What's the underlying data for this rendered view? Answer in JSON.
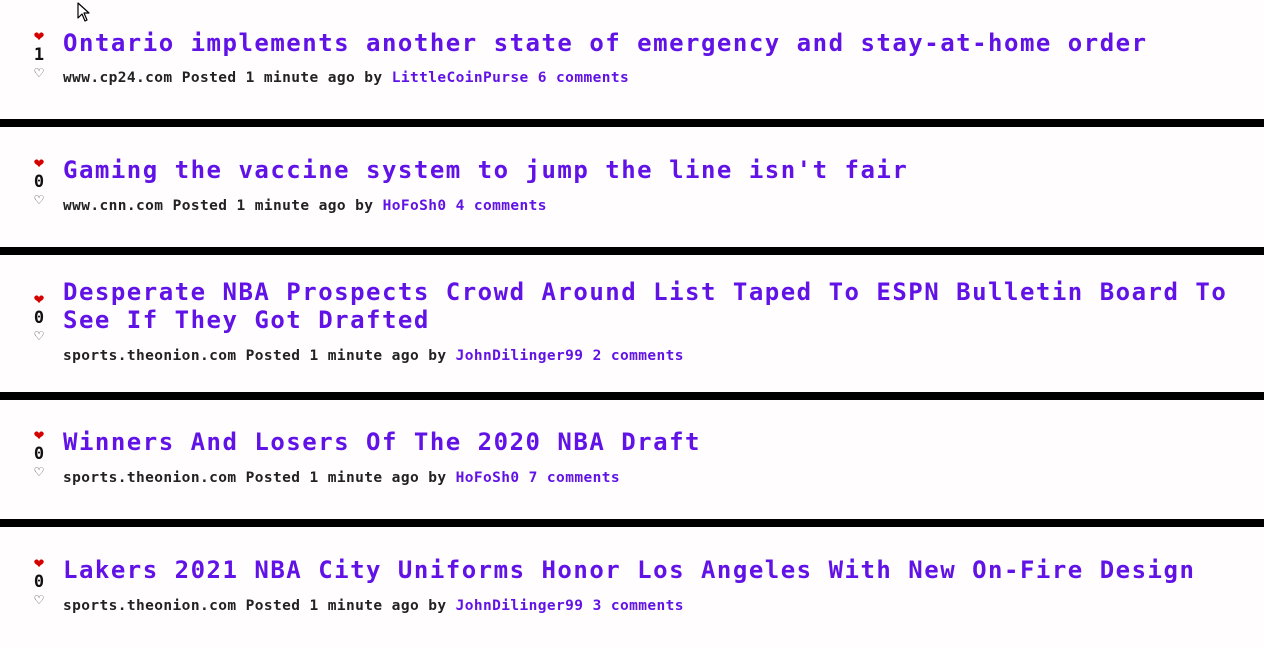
{
  "colors": {
    "accent": "#6112e6",
    "upvote": "#d40000",
    "divider": "#000000"
  },
  "icons": {
    "upvote": "heart-filled-icon",
    "downvote": "heart-outline-icon",
    "pointer": "mouse-cursor-icon"
  },
  "posts": [
    {
      "votes": "1",
      "title": "Ontario implements another state of emergency and stay-at-home order",
      "domain": "www.cp24.com",
      "posted": "Posted 1 minute ago by",
      "author": "LittleCoinPurse",
      "comments": "6 comments"
    },
    {
      "votes": "0",
      "title": "Gaming the vaccine system to jump the line isn't fair",
      "domain": "www.cnn.com",
      "posted": "Posted 1 minute ago by",
      "author": "HoFoSh0",
      "comments": "4 comments"
    },
    {
      "votes": "0",
      "title": "Desperate NBA Prospects Crowd Around List Taped To ESPN Bulletin Board To See If They Got Drafted",
      "domain": "sports.theonion.com",
      "posted": "Posted 1 minute ago by",
      "author": "JohnDilinger99",
      "comments": "2 comments"
    },
    {
      "votes": "0",
      "title": "Winners And Losers Of The 2020 NBA Draft",
      "domain": "sports.theonion.com",
      "posted": "Posted 1 minute ago by",
      "author": "HoFoSh0",
      "comments": "7 comments"
    },
    {
      "votes": "0",
      "title": "Lakers 2021 NBA City Uniforms Honor Los Angeles With New On-Fire Design",
      "domain": "sports.theonion.com",
      "posted": "Posted 1 minute ago by",
      "author": "JohnDilinger99",
      "comments": "3 comments"
    }
  ]
}
